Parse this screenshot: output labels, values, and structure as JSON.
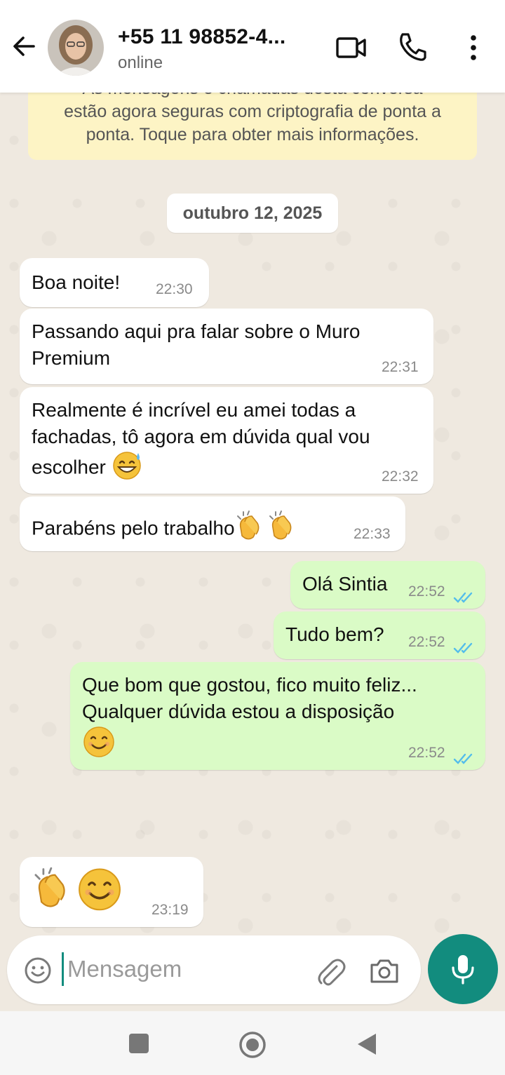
{
  "header": {
    "contact_name": "+55 11 98852-4...",
    "status": "online",
    "icons": [
      "back-arrow-icon",
      "video-call-icon",
      "phone-icon",
      "more-vert-icon"
    ]
  },
  "encryption_notice": {
    "line1": "As mensagens e chamadas desta conversa",
    "line2": "estão agora seguras com criptografia de ponta a",
    "line3": "ponta. Toque para obter mais informações."
  },
  "date_label": "outubro 12, 2025",
  "messages": [
    {
      "direction": "in",
      "text": "Boa noite!",
      "time": "22:30"
    },
    {
      "direction": "in",
      "line1": "Passando aqui pra falar sobre o Muro",
      "line2": "Premium",
      "time": "22:31"
    },
    {
      "direction": "in",
      "line1": "Realmente é incrível eu amei todas a",
      "line2": "fachadas, tô agora em dúvida qual vou",
      "line3": "escolher",
      "emoji": "grinning-sweat-emoji",
      "time": "22:32"
    },
    {
      "direction": "in",
      "text": "Parabéns pelo trabalho",
      "emoji": "clapping-hands-emoji x2",
      "time": "22:33"
    },
    {
      "direction": "out",
      "text": "Olá Sintia",
      "time": "22:52",
      "status": "read"
    },
    {
      "direction": "out",
      "text": "Tudo bem?",
      "time": "22:52",
      "status": "read"
    },
    {
      "direction": "out",
      "line1": "Que bom que gostou, fico muito feliz...",
      "line2": "Qualquer dúvida estou a disposição",
      "emoji": "smiling-face-emoji",
      "time": "22:52",
      "status": "read"
    },
    {
      "direction": "in",
      "emoji": "clapping-hands-emoji + smiling-face-emoji",
      "time": "23:19"
    }
  ],
  "composer": {
    "placeholder": "Mensagem",
    "value": ""
  },
  "colors": {
    "accent": "#128c7e",
    "outgoing_bubble": "#dafbc6",
    "incoming_bubble": "#ffffff",
    "notice_bg": "#fdf4c5",
    "read_ticks": "#53bdeb"
  }
}
